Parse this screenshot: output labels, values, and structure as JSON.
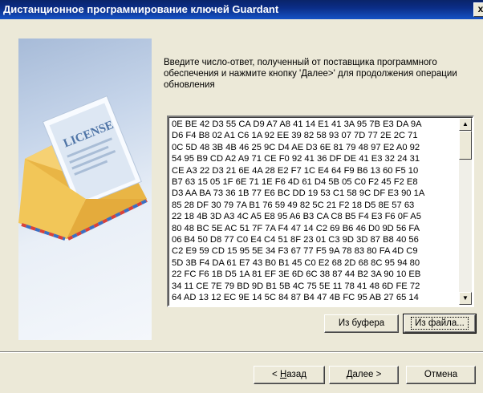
{
  "window": {
    "title": "Дистанционное программирование ключей Guardant",
    "close_label": "x"
  },
  "sidepanel": {
    "image_label": "LICENSE",
    "colors": {
      "panel_top": "#a7bbd8",
      "envelope": "#f2c658",
      "envelope_dark": "#d99a2b",
      "stripe_red": "#d9413a",
      "stripe_blue": "#3c6fc2"
    }
  },
  "instruction": "Введите число-ответ, полученный от поставщика программного обеспечения и нажмите кнопку 'Далее>' для продолжения операции обновления",
  "hex_lines": [
    "0E BE 42 D3 55 CA D9 A7 A8 41 14 E1 41 3A 95 7B E3 DA 9A",
    "D6 F4 B8 02 A1 C6 1A 92 EE 39 82 58 93 07 7D 77 2E 2C 71",
    "0C 5D 48 3B 4B 46 25 9C D4 AE D3 6E 81 79 48 97 E2 A0 92",
    "54 95 B9 CD A2 A9 71 CE F0 92 41 36 DF DE 41 E3 32 24 31",
    "CE A3 22 D3 21 6E 4A 28 E2 F7 1C E4 64 F9 B6 13 60 F5 10",
    "B7 63 15 05 1F 6E 71 1E F6 4D 61 D4 5B 05 C0 F2 45 F2 E8",
    "D3 AA BA 73 36 1B 77 E6 BC DD 19 53 C1 58 9C DF E3 90 1A",
    "85 28 DF 30 79 7A B1 76 59 49 82 5C 21 F2 18 D5 8E 57 63",
    "22 18 4B 3D A3 4C A5 E8 95 A6 B3 CA C8 B5 F4 E3 F6 0F A5",
    "80 48 BC 5E AC 51 7F 7A F4 47 14 C2 69 B6 46 D0 9D 56 FA",
    "06 B4 50 D8 77 C0 E4 C4 51 8F 23 01 C3 9D 3D 87 B8 40 56",
    "C2 E9 59 CD 15 95 5E 34 F3 67 77 F5 9A 78 83 80 FA 4D C9",
    "5D 3B F4 DA 61 E7 43 B0 B1 45 C0 E2 68 2D 68 8C 95 94 80",
    "22 FC F6 1B D5 1A 81 EF 3E 6D 6C 38 87 44 B2 3A 90 10 EB",
    "34 11 CE 7E 79 BD 9D B1 5B 4C 75 5E 11 78 41 48 6D FE 72",
    "64 AD 13 12 EC 9E 14 5C 84 87 B4 47 4B FC 95 AB 27 65 14"
  ],
  "buttons": {
    "from_buffer": "Из буфера",
    "from_file": "Из файла...",
    "back_prefix": "< ",
    "back_mnemonic": "Н",
    "back_rest": "азад",
    "next_mnemonic": "Д",
    "next_rest": "алее >",
    "cancel": "Отмена"
  }
}
